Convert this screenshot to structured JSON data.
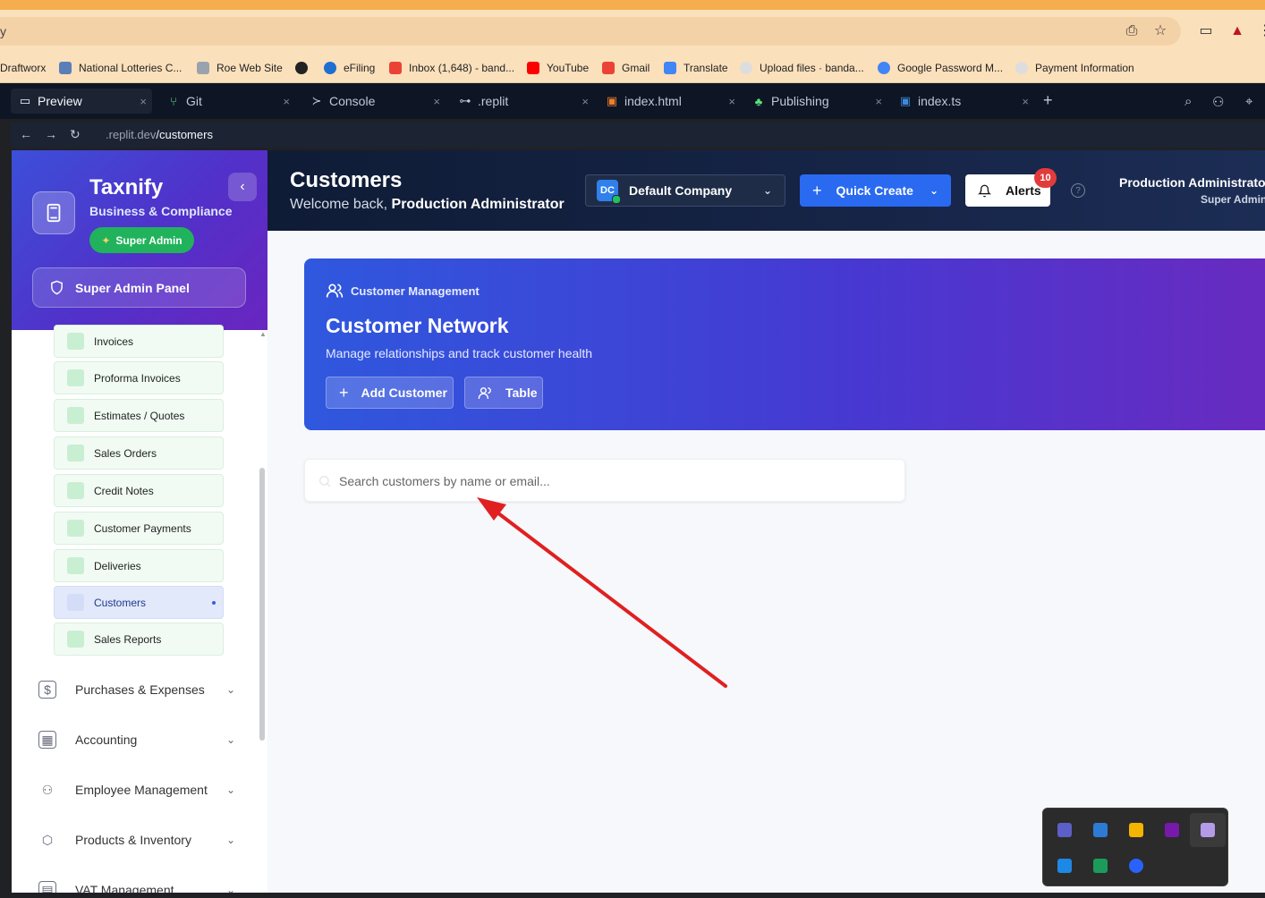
{
  "browser": {
    "address_fragment": "y",
    "bookmarks": [
      "Draftworx",
      "National Lotteries C...",
      "Roe Web Site",
      "",
      "eFiling",
      "Inbox (1,648) - band...",
      "YouTube",
      "Gmail",
      "Translate",
      "Upload files · banda...",
      "Google Password M...",
      "Payment Information"
    ]
  },
  "ide": {
    "tabs": [
      {
        "label": "Preview",
        "icon": "preview-icon"
      },
      {
        "label": "Git",
        "icon": "git-icon"
      },
      {
        "label": "Console",
        "icon": "console-icon"
      },
      {
        "label": ".replit",
        "icon": "config-icon"
      },
      {
        "label": "index.html",
        "icon": "html-icon"
      },
      {
        "label": "Publishing",
        "icon": "publishing-icon"
      },
      {
        "label": "index.ts",
        "icon": "typescript-icon"
      }
    ],
    "url_prefix": ".replit.dev",
    "url_path": "/customers"
  },
  "sidebar": {
    "brand": "Taxnify",
    "subtitle": "Business & Compliance",
    "role_badge": "Super Admin",
    "panel_button": "Super Admin Panel",
    "sub_items": [
      "Invoices",
      "Proforma Invoices",
      "Estimates / Quotes",
      "Sales Orders",
      "Credit Notes",
      "Customer Payments",
      "Deliveries",
      "Customers",
      "Sales Reports"
    ],
    "active_item": "Customers",
    "groups": [
      "Purchases & Expenses",
      "Accounting",
      "Employee Management",
      "Products & Inventory",
      "VAT Management"
    ]
  },
  "header": {
    "title": "Customers",
    "welcome_prefix": "Welcome back,",
    "welcome_name": "Production Administrator",
    "company_initials": "DC",
    "company": "Default Company",
    "quick_create": "Quick Create",
    "alerts": "Alerts",
    "alerts_count": "10",
    "help": "?",
    "user_name": "Production Administrator",
    "user_role": "Super Admin"
  },
  "hero": {
    "tag": "Customer Management",
    "title": "Customer Network",
    "subtitle": "Manage relationships and track customer health",
    "add_button": "Add Customer",
    "view_button": "Table"
  },
  "search": {
    "placeholder": "Search customers by name or email..."
  },
  "colors": {
    "accent": "#2a6af0",
    "annotation_arrow": "#e02020",
    "badge_green": "#21b35b",
    "alert_red": "#e23b3b"
  }
}
